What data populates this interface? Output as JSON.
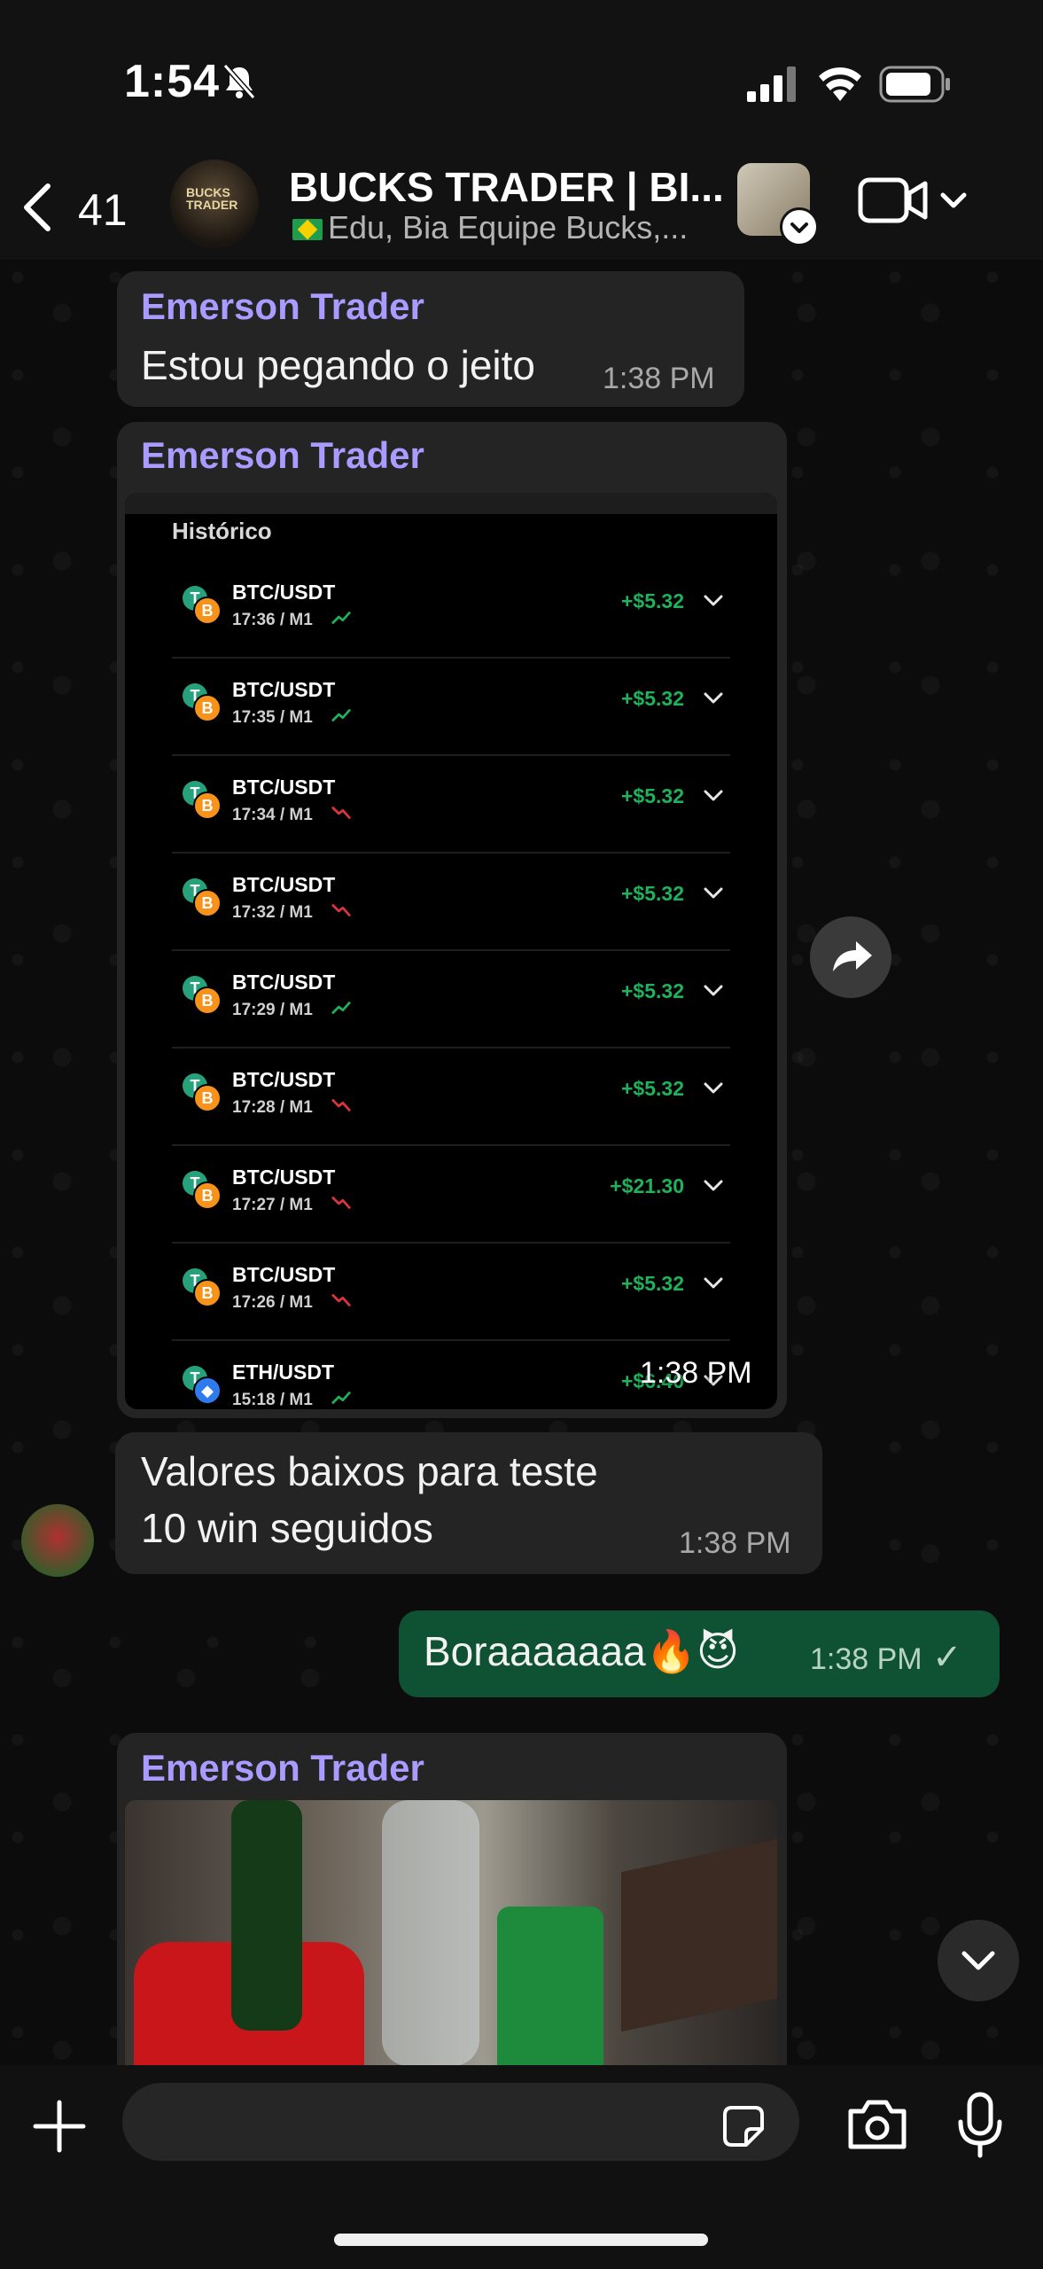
{
  "status_bar": {
    "time": "1:54"
  },
  "header": {
    "back_count": "41",
    "group_name": "BUCKS TRADER | BI...",
    "group_members": "Edu, Bia Equipe Bucks,...",
    "avatar_text": "BUCKS TRADER"
  },
  "messages": [
    {
      "sender": "Emerson Trader",
      "text": "Estou pegando o jeito",
      "time": "1:38 PM"
    },
    {
      "sender": "Emerson Trader",
      "time": "1:38 PM"
    },
    {
      "lines": [
        "Valores baixos para teste",
        "10 win seguidos"
      ],
      "time": "1:38 PM"
    },
    {
      "text": "Boraaaaaaa🔥😈",
      "time": "1:38 PM",
      "check": "✓"
    },
    {
      "sender": "Emerson Trader"
    }
  ],
  "history": {
    "title": "Histórico",
    "trades": [
      {
        "pair": "BTC/USDT",
        "meta": "17:36 / M1",
        "profit": "+$5.32",
        "trend": "up"
      },
      {
        "pair": "BTC/USDT",
        "meta": "17:35 / M1",
        "profit": "+$5.32",
        "trend": "up"
      },
      {
        "pair": "BTC/USDT",
        "meta": "17:34 / M1",
        "profit": "+$5.32",
        "trend": "down"
      },
      {
        "pair": "BTC/USDT",
        "meta": "17:32 / M1",
        "profit": "+$5.32",
        "trend": "down"
      },
      {
        "pair": "BTC/USDT",
        "meta": "17:29 / M1",
        "profit": "+$5.32",
        "trend": "up"
      },
      {
        "pair": "BTC/USDT",
        "meta": "17:28 / M1",
        "profit": "+$5.32",
        "trend": "down"
      },
      {
        "pair": "BTC/USDT",
        "meta": "17:27 / M1",
        "profit": "+$21.30",
        "trend": "down"
      },
      {
        "pair": "BTC/USDT",
        "meta": "17:26 / M1",
        "profit": "+$5.32",
        "trend": "down"
      },
      {
        "pair": "ETH/USDT",
        "meta": "15:18 / M1",
        "profit": "+$6.40",
        "trend": "up"
      }
    ]
  },
  "input": {
    "placeholder": ""
  },
  "colors": {
    "sender": "#a99bff",
    "profit": "#20b25a",
    "outgoing_bubble": "#0f5133"
  },
  "icons": [
    "bell-off-icon",
    "signal-icon",
    "wifi-icon",
    "battery-icon",
    "back-chevron-icon",
    "video-call-icon",
    "forward-icon",
    "scroll-down-icon",
    "plus-icon",
    "sticker-icon",
    "camera-icon",
    "mic-icon"
  ]
}
